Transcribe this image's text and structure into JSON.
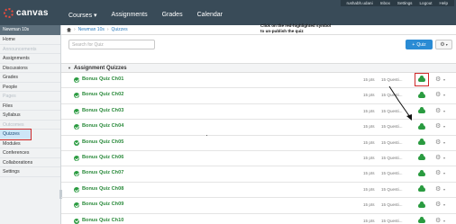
{
  "app": {
    "logo_text": "canvas"
  },
  "topnav": {
    "items": [
      "Courses ▾",
      "Assignments",
      "Grades",
      "Calendar"
    ]
  },
  "usermenu": {
    "items": [
      "rushabh.udani",
      "Inbox",
      "Settings",
      "Logout",
      "Help"
    ]
  },
  "breadcrumb": {
    "course": "Newman 10s",
    "page": "Quizzes",
    "separator": "›"
  },
  "sidebar": {
    "course_title": "Newman 10s",
    "items": [
      {
        "label": "Home",
        "state": "normal"
      },
      {
        "label": "Announcements",
        "state": "muted"
      },
      {
        "label": "Assignments",
        "state": "normal"
      },
      {
        "label": "Discussions",
        "state": "normal"
      },
      {
        "label": "Grades",
        "state": "normal"
      },
      {
        "label": "People",
        "state": "normal"
      },
      {
        "label": "Pages",
        "state": "muted"
      },
      {
        "label": "Files",
        "state": "normal"
      },
      {
        "label": "Syllabus",
        "state": "normal"
      },
      {
        "label": "Outcomes",
        "state": "muted"
      },
      {
        "label": "Quizzes",
        "state": "active"
      },
      {
        "label": "Modules",
        "state": "normal"
      },
      {
        "label": "Conferences",
        "state": "normal"
      },
      {
        "label": "Collaborations",
        "state": "normal"
      },
      {
        "label": "Settings",
        "state": "normal"
      }
    ]
  },
  "toolbar": {
    "search_placeholder": "Search for Quiz",
    "add_label": "Quiz",
    "add_icon": "+"
  },
  "group": {
    "title": "Assignment Quizzes"
  },
  "quizzes": [
    {
      "name": "Bonus Quiz Ch01",
      "points": "15 pts",
      "questions": "15 Questi...",
      "highlighted": true
    },
    {
      "name": "Bonus Quiz Ch02",
      "points": "15 pts",
      "questions": "15 Questi...",
      "highlighted": false
    },
    {
      "name": "Bonus Quiz Ch03",
      "points": "15 pts",
      "questions": "15 Questi...",
      "highlighted": false
    },
    {
      "name": "Bonus Quiz Ch04",
      "points": "15 pts",
      "questions": "15 Questi...",
      "highlighted": false
    },
    {
      "name": "Bonus Quiz Ch05",
      "points": "15 pts",
      "questions": "15 Questi...",
      "highlighted": false
    },
    {
      "name": "Bonus Quiz Ch06",
      "points": "15 pts",
      "questions": "15 Questi...",
      "highlighted": false
    },
    {
      "name": "Bonus Quiz Ch07",
      "points": "15 pts",
      "questions": "15 Questi...",
      "highlighted": false
    },
    {
      "name": "Bonus Quiz Ch08",
      "points": "15 pts",
      "questions": "15 Questi...",
      "highlighted": false
    },
    {
      "name": "Bonus Quiz Ch09",
      "points": "15 pts",
      "questions": "15 Questi...",
      "highlighted": false
    },
    {
      "name": "Bonus Quiz Ch10",
      "points": "15 pts",
      "questions": "15 Questi...",
      "highlighted": false
    }
  ],
  "callout": {
    "text": "Click on the red-highlighted symbol to un-publish the quiz"
  },
  "colors": {
    "header": "#394b58",
    "accent": "#2a8bd4",
    "published": "#2a9b40",
    "highlight": "#cf2a2a"
  },
  "icons": {
    "published": "cloud-check-icon",
    "settings": "gear-icon",
    "menu": "chevron-down-icon",
    "home": "home-icon"
  }
}
